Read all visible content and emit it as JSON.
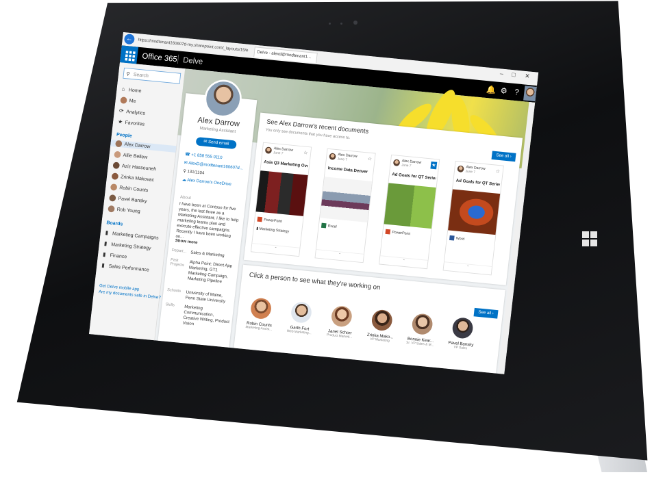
{
  "browser": {
    "address": "https://modtenant160607d-my.sharepoint.com/_layouts/15/e",
    "tab_label": "Delve - alexd@modtenant1..."
  },
  "suite": {
    "brand": "Office 365",
    "app": "Delve"
  },
  "search": {
    "placeholder": "Search"
  },
  "nav": {
    "items": [
      "Home",
      "Me",
      "Analytics",
      "Favorites"
    ],
    "people_heading": "People",
    "people": [
      "Alex Darrow",
      "Allie Bellew",
      "Aziz Hassouneh",
      "Zrinka Makovac",
      "Robin Counts",
      "Pavel Bansky",
      "Rob Young"
    ],
    "boards_heading": "Boards",
    "boards": [
      "Marketing Campaigns",
      "Marketing Strategy",
      "Finance",
      "Sales Performance"
    ],
    "footer_links": [
      "Get Delve mobile app",
      "Are my documents safe in Delve?"
    ]
  },
  "profile": {
    "name": "Alex Darrow",
    "title": "Marketing Assistant",
    "send_email": "Send email",
    "phone": "+1 858 555 0110",
    "email": "AlexD@modtenant160607d...",
    "office": "131/1104",
    "onedrive": "Alex Darrow's OneDrive",
    "about_heading": "About",
    "about": "I have been at Contoso for five years, the last three as a Marketing Assistant. I like to help marketing teams plan and execute effective campaigns. Recently I have been working on...",
    "show_more": "Show more",
    "department_label": "Depart...",
    "department": "Sales & Marketing",
    "past_projects_label": "Past Projects",
    "past_projects": "Alpha Point: Direct App Marketing, GT1 Marketing Campaign, Marketing Pipeline",
    "schools_label": "Schools",
    "schools": "University of Maine, Penn State University",
    "skills_label": "Skills",
    "skills": "Marketing Communication, Creative Writing, Product Vision"
  },
  "documents_card": {
    "title": "See Alex Darrow's recent documents",
    "subtitle": "You only see documents that you have access to.",
    "see_all": "See all",
    "docs": [
      {
        "author": "Alex Darrow",
        "date": "June 7",
        "title": "Asia Q3 Marketing Ove...",
        "app": "PowerPoint",
        "board": "Marketing Strategy",
        "app_color": "#d24726"
      },
      {
        "author": "Alex Darrow",
        "date": "June 7",
        "title": "Income Data Denver",
        "app": "Excel",
        "board": "",
        "app_color": "#217346"
      },
      {
        "author": "Alex Darrow",
        "date": "June 7",
        "title": "Ad Goals for QT Series",
        "app": "PowerPoint",
        "board": "",
        "app_color": "#d24726"
      },
      {
        "author": "Alex Darrow",
        "date": "June 7",
        "title": "Ad Goals for QT Series",
        "app": "Word",
        "board": "",
        "app_color": "#2b579a"
      }
    ]
  },
  "people_card": {
    "title": "Click a person to see what they're working on",
    "see_all": "See all",
    "people": [
      {
        "name": "Robin Counts",
        "title": "Marketing Assist..."
      },
      {
        "name": "Garth Fort",
        "title": "Web Marketing..."
      },
      {
        "name": "Janet Schorr",
        "title": "Product Marketi..."
      },
      {
        "name": "Zrinka Mako...",
        "title": "VP Marketing"
      },
      {
        "name": "Bonnie Kear...",
        "title": "Sr. VP Sales & M..."
      },
      {
        "name": "Pavel Bansky",
        "title": "VP Sales"
      }
    ]
  }
}
